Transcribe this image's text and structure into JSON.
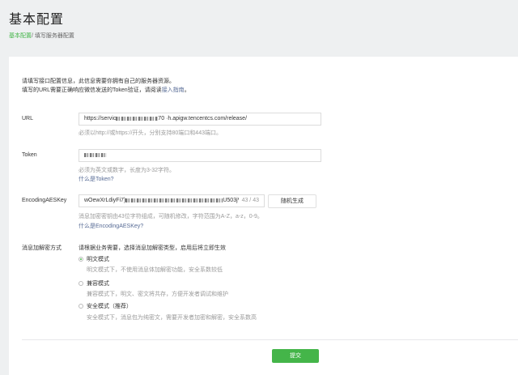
{
  "header": {
    "title": "基本配置",
    "breadcrumb_link": "基本配置",
    "breadcrumb_sep": "/",
    "breadcrumb_current": "填写服务器配置"
  },
  "intro": {
    "line1": "请填写接口配置信息，此信息需要你拥有自己的服务器资源。",
    "line2_prefix": "填写的URL需要正确响应微信发送的Token验证，请阅读",
    "line2_link": "接入指南",
    "line2_suffix": "。"
  },
  "url": {
    "label": "URL",
    "value_prefix": "https://servic",
    "value_suffix": "70 ·h.apigw.tencentcs.com/release/",
    "hint": "必须以http://或https://开头，分别支持80端口和443端口。"
  },
  "token": {
    "label": "Token",
    "hint": "必须为英文或数字，长度为3-32字符。",
    "link": "什么是Token?"
  },
  "aeskey": {
    "label": "EncodingAESKey",
    "value_prefix": "wOewXrLdiyFi7)",
    "value_suffix": "U503jV6i",
    "counter": "43 / 43",
    "generate_label": "随机生成",
    "hint": "消息加密密钥由43位字符组成，可随机修改，字符范围为A-Z，a-z，0-9。",
    "link": "什么是EncodingAESKey?"
  },
  "encryption": {
    "label": "消息加解密方式",
    "intro": "请根据业务需要，选择消息加解密类型，启用后将立即生效",
    "options": [
      {
        "label": "明文模式",
        "desc": "明文模式下，不使用消息体加解密功能，安全系数较低",
        "checked": true
      },
      {
        "label": "兼容模式",
        "desc": "兼容模式下，明文、密文将共存，方便开发者调试和维护",
        "checked": false
      },
      {
        "label": "安全模式（推荐）",
        "desc": "安全模式下，消息包为纯密文，需要开发者加密和解密，安全系数高",
        "checked": false
      }
    ]
  },
  "submit_label": "提交",
  "colors": {
    "accent": "#44b549",
    "link": "#576b95",
    "hint": "#9a9a9a"
  }
}
